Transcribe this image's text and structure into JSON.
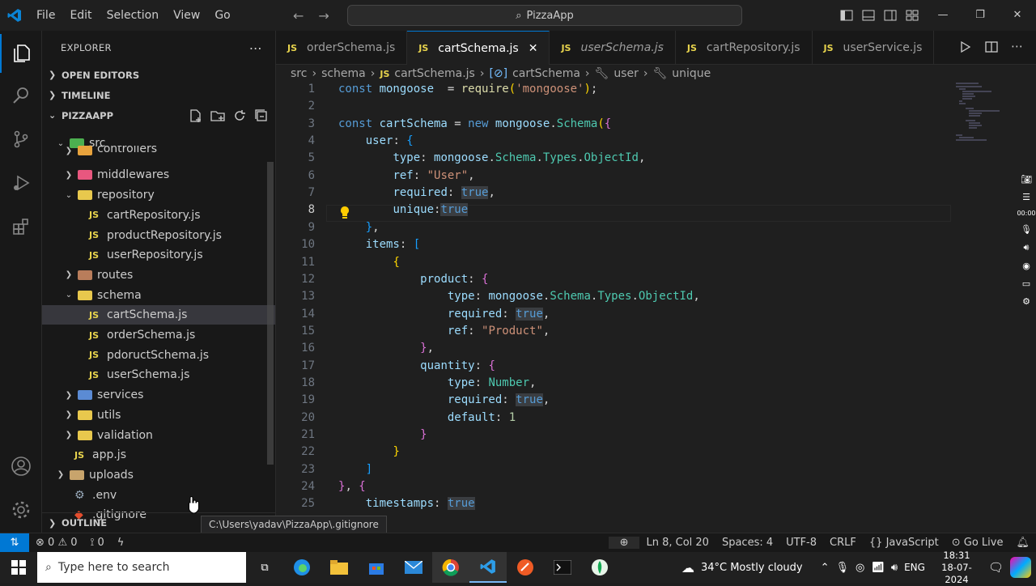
{
  "menu": [
    "File",
    "Edit",
    "Selection",
    "View",
    "Go"
  ],
  "command_center": "PizzaApp",
  "explorer": {
    "title": "EXPLORER",
    "open_editors": "OPEN EDITORS",
    "timeline": "TIMELINE",
    "project": "PIZZAAPP",
    "outline": "OUTLINE",
    "tree": [
      {
        "label": "src",
        "kind": "folder-open",
        "indent": 0,
        "color": "#4caf50"
      },
      {
        "label": "controllers",
        "kind": "folder",
        "indent": 1,
        "color": "#e8a33d",
        "partial": true
      },
      {
        "label": "middlewares",
        "kind": "folder",
        "indent": 1,
        "color": "#e8577f"
      },
      {
        "label": "repository",
        "kind": "folder-open",
        "indent": 1,
        "color": "#e8c84d"
      },
      {
        "label": "cartRepository.js",
        "kind": "js",
        "indent": 2
      },
      {
        "label": "productRepository.js",
        "kind": "js",
        "indent": 2
      },
      {
        "label": "userRepository.js",
        "kind": "js",
        "indent": 2
      },
      {
        "label": "routes",
        "kind": "folder",
        "indent": 1,
        "color": "#b97d5b"
      },
      {
        "label": "schema",
        "kind": "folder-open",
        "indent": 1,
        "color": "#e8c84d"
      },
      {
        "label": "cartSchema.js",
        "kind": "js",
        "indent": 2,
        "selected": true
      },
      {
        "label": "orderSchema.js",
        "kind": "js",
        "indent": 2
      },
      {
        "label": "pdoructSchema.js",
        "kind": "js",
        "indent": 2
      },
      {
        "label": "userSchema.js",
        "kind": "js",
        "indent": 2
      },
      {
        "label": "services",
        "kind": "folder",
        "indent": 1,
        "color": "#5b8bd4"
      },
      {
        "label": "utils",
        "kind": "folder",
        "indent": 1,
        "color": "#e8c84d"
      },
      {
        "label": "validation",
        "kind": "folder",
        "indent": 1,
        "color": "#e8c84d"
      },
      {
        "label": "app.js",
        "kind": "js",
        "indent": 1
      },
      {
        "label": "uploads",
        "kind": "folder",
        "indent": 0,
        "color": "#c8a46c"
      },
      {
        "label": ".env",
        "kind": "gear",
        "indent": 0
      },
      {
        "label": ".gitignore",
        "kind": "git",
        "indent": 0
      }
    ]
  },
  "tabs": [
    {
      "label": "orderSchema.js",
      "italic": false,
      "active": false
    },
    {
      "label": "cartSchema.js",
      "italic": false,
      "active": true
    },
    {
      "label": "userSchema.js",
      "italic": true,
      "active": false
    },
    {
      "label": "cartRepository.js",
      "italic": false,
      "active": false
    },
    {
      "label": "userService.js",
      "italic": false,
      "active": false
    }
  ],
  "breadcrumbs": [
    "src",
    "schema",
    "cartSchema.js",
    "cartSchema",
    "user",
    "unique"
  ],
  "code": [
    [
      [
        "kw",
        "const "
      ],
      [
        "var",
        "mongoose"
      ],
      [
        "",
        "  = "
      ],
      [
        "fn",
        "require"
      ],
      [
        "b1",
        "("
      ],
      [
        "str",
        "'mongoose'"
      ],
      [
        "b1",
        ")"
      ],
      [
        "",
        ";"
      ]
    ],
    [],
    [
      [
        "kw",
        "const "
      ],
      [
        "var",
        "cartSchema"
      ],
      [
        "",
        " = "
      ],
      [
        "kw",
        "new "
      ],
      [
        "var",
        "mongoose"
      ],
      [
        "",
        "."
      ],
      [
        "cls",
        "Schema"
      ],
      [
        "b1",
        "("
      ],
      [
        "b2",
        "{"
      ]
    ],
    [
      [
        "",
        "    "
      ],
      [
        "prop",
        "user"
      ],
      [
        "",
        ": "
      ],
      [
        "b3",
        "{"
      ]
    ],
    [
      [
        "",
        "        "
      ],
      [
        "prop",
        "type"
      ],
      [
        "",
        ": "
      ],
      [
        "var",
        "mongoose"
      ],
      [
        "",
        "."
      ],
      [
        "cls",
        "Schema"
      ],
      [
        "",
        "."
      ],
      [
        "cls",
        "Types"
      ],
      [
        "",
        "."
      ],
      [
        "cls",
        "ObjectId"
      ],
      [
        "",
        ","
      ]
    ],
    [
      [
        "",
        "        "
      ],
      [
        "prop",
        "ref"
      ],
      [
        "",
        ": "
      ],
      [
        "str",
        "\"User\""
      ],
      [
        "",
        ","
      ]
    ],
    [
      [
        "",
        "        "
      ],
      [
        "prop",
        "required"
      ],
      [
        "",
        ": "
      ],
      [
        "tv",
        "true"
      ],
      [
        "",
        ","
      ]
    ],
    [
      [
        "",
        "        "
      ],
      [
        "prop",
        "unique"
      ],
      [
        "",
        ":"
      ],
      [
        "tv",
        "true"
      ]
    ],
    [
      [
        "",
        "    "
      ],
      [
        "b3",
        "}"
      ],
      [
        "",
        ","
      ]
    ],
    [
      [
        "",
        "    "
      ],
      [
        "prop",
        "items"
      ],
      [
        "",
        ": "
      ],
      [
        "b3",
        "["
      ]
    ],
    [
      [
        "",
        "        "
      ],
      [
        "b1",
        "{"
      ]
    ],
    [
      [
        "",
        "            "
      ],
      [
        "prop",
        "product"
      ],
      [
        "",
        ": "
      ],
      [
        "b2",
        "{"
      ]
    ],
    [
      [
        "",
        "                "
      ],
      [
        "prop",
        "type"
      ],
      [
        "",
        ": "
      ],
      [
        "var",
        "mongoose"
      ],
      [
        "",
        "."
      ],
      [
        "cls",
        "Schema"
      ],
      [
        "",
        "."
      ],
      [
        "cls",
        "Types"
      ],
      [
        "",
        "."
      ],
      [
        "cls",
        "ObjectId"
      ],
      [
        "",
        ","
      ]
    ],
    [
      [
        "",
        "                "
      ],
      [
        "prop",
        "required"
      ],
      [
        "",
        ": "
      ],
      [
        "tv",
        "true"
      ],
      [
        "",
        ","
      ]
    ],
    [
      [
        "",
        "                "
      ],
      [
        "prop",
        "ref"
      ],
      [
        "",
        ": "
      ],
      [
        "str",
        "\"Product\""
      ],
      [
        "",
        ","
      ]
    ],
    [
      [
        "",
        "            "
      ],
      [
        "b2",
        "}"
      ],
      [
        "",
        ","
      ]
    ],
    [
      [
        "",
        "            "
      ],
      [
        "prop",
        "quantity"
      ],
      [
        "",
        ": "
      ],
      [
        "b2",
        "{"
      ]
    ],
    [
      [
        "",
        "                "
      ],
      [
        "prop",
        "type"
      ],
      [
        "",
        ": "
      ],
      [
        "cls",
        "Number"
      ],
      [
        "",
        ","
      ]
    ],
    [
      [
        "",
        "                "
      ],
      [
        "prop",
        "required"
      ],
      [
        "",
        ": "
      ],
      [
        "tv",
        "true"
      ],
      [
        "",
        ","
      ]
    ],
    [
      [
        "",
        "                "
      ],
      [
        "prop",
        "default"
      ],
      [
        "",
        ": "
      ],
      [
        "num",
        "1"
      ]
    ],
    [
      [
        "",
        "            "
      ],
      [
        "b2",
        "}"
      ]
    ],
    [
      [
        "",
        "        "
      ],
      [
        "b1",
        "}"
      ]
    ],
    [
      [
        "",
        "    "
      ],
      [
        "b3",
        "]"
      ]
    ],
    [
      [
        "b2",
        "}"
      ],
      [
        "",
        ", "
      ],
      [
        "b2",
        "{"
      ]
    ],
    [
      [
        "",
        "    "
      ],
      [
        "prop",
        "timestamps"
      ],
      [
        "",
        ": "
      ],
      [
        "tv",
        "true"
      ]
    ]
  ],
  "status": {
    "errors": "0",
    "warnings": "0",
    "ports": "0",
    "position": "Ln 8, Col 20",
    "spaces": "Spaces: 4",
    "encoding": "UTF-8",
    "eol": "CRLF",
    "language": "JavaScript",
    "golive": "Go Live"
  },
  "tooltip": "C:\\Users\\yadav\\PizzaApp\\.gitignore",
  "taskbar": {
    "search_placeholder": "Type here to search",
    "weather": "34°C  Mostly cloudy",
    "lang": "ENG",
    "time": "18:31",
    "date": "18-07-2024"
  }
}
